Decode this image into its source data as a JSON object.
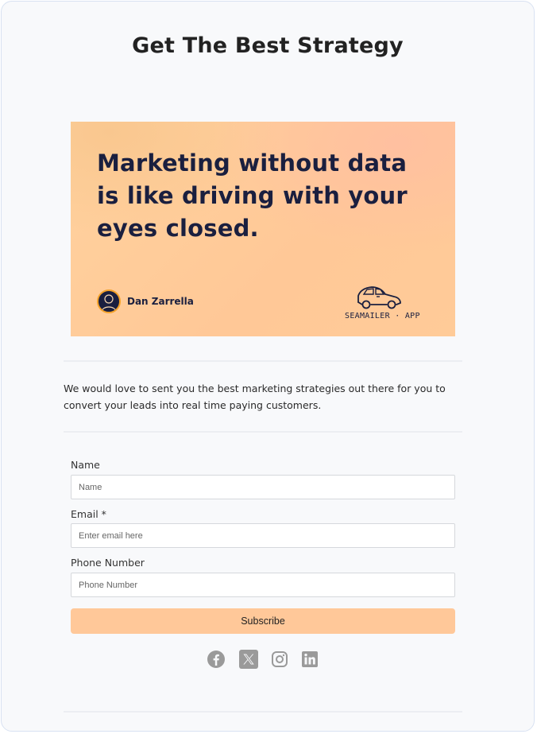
{
  "page": {
    "title": "Get The Best Strategy"
  },
  "hero": {
    "quote": "Marketing without data is like driving with your eyes closed.",
    "author": "Dan Zarrella",
    "brand": "SEAMAILER · APP"
  },
  "description": "We would love to sent you the best marketing strategies out there for you to convert your leads into real time paying customers.",
  "form": {
    "name_label": "Name",
    "name_placeholder": "Name",
    "email_label": "Email *",
    "email_placeholder": "Enter email here",
    "phone_label": "Phone Number",
    "phone_placeholder": "Phone Number",
    "submit_label": "Subscribe"
  },
  "social": {
    "icons": [
      "facebook-icon",
      "x-icon",
      "instagram-icon",
      "linkedin-icon"
    ],
    "color": "#9a9a9a"
  },
  "colors": {
    "button": "#ffc899",
    "quote_text": "#1a1f3f"
  }
}
